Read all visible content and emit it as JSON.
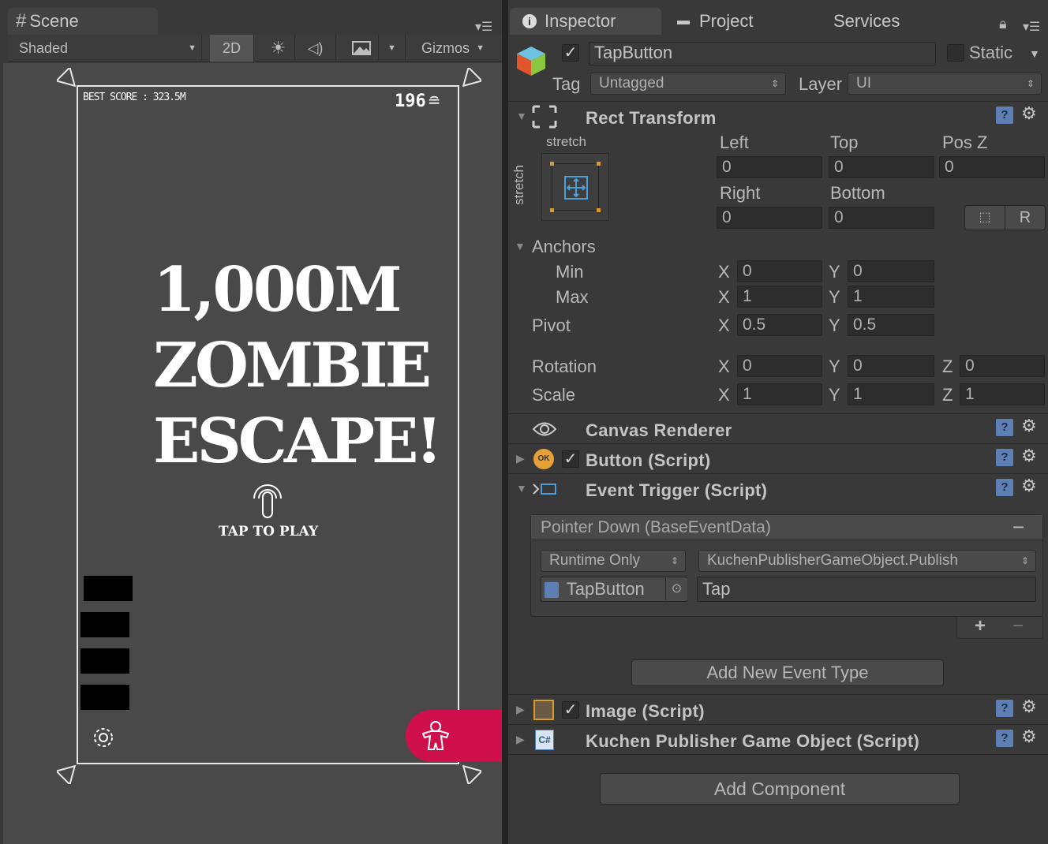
{
  "scene_tab": {
    "label": "Scene"
  },
  "scene_toolbar": {
    "shading": "Shaded",
    "mode_2d": "2D",
    "gizmos": "Gizmos"
  },
  "game": {
    "best_score": "BEST SCORE : 323.5M",
    "coins": "196",
    "title_line1": "1,000M",
    "title_line2": "ZOMBIE",
    "title_line3": "ESCAPE!",
    "tap_to_play": "TAP TO PLAY"
  },
  "inspector_tabs": {
    "inspector": "Inspector",
    "project": "Project",
    "services": "Services"
  },
  "object": {
    "name": "TapButton",
    "static_label": "Static",
    "tag_label": "Tag",
    "tag_value": "Untagged",
    "layer_label": "Layer",
    "layer_value": "UI"
  },
  "rect_transform": {
    "title": "Rect Transform",
    "stretch_h": "stretch",
    "stretch_v": "stretch",
    "left_label": "Left",
    "left": "0",
    "top_label": "Top",
    "top": "0",
    "posz_label": "Pos Z",
    "posz": "0",
    "right_label": "Right",
    "right": "0",
    "bottom_label": "Bottom",
    "bottom": "0",
    "r_button": "R",
    "anchors_label": "Anchors",
    "min_label": "Min",
    "min_x": "0",
    "min_y": "0",
    "max_label": "Max",
    "max_x": "1",
    "max_y": "1",
    "pivot_label": "Pivot",
    "pivot_x": "0.5",
    "pivot_y": "0.5",
    "rotation_label": "Rotation",
    "rot_x": "0",
    "rot_y": "0",
    "rot_z": "0",
    "scale_label": "Scale",
    "scale_x": "1",
    "scale_y": "1",
    "scale_z": "1",
    "axis_x": "X",
    "axis_y": "Y",
    "axis_z": "Z"
  },
  "components": {
    "canvas_renderer": "Canvas Renderer",
    "button": "Button (Script)",
    "event_trigger": "Event Trigger (Script)",
    "image": "Image (Script)",
    "kuchen": "Kuchen Publisher Game Object (Script)",
    "ok_badge": "OK"
  },
  "event": {
    "header": "Pointer Down (BaseEventData)",
    "runtime": "Runtime Only",
    "function": "KuchenPublisherGameObject.Publish",
    "target": "TapButton",
    "argument": "Tap",
    "plus": "+",
    "minus": "−",
    "header_minus": "−",
    "add_event": "Add New Event Type"
  },
  "add_component": "Add Component",
  "help_glyph": "?",
  "gear_glyph": "⚙",
  "colors": {
    "accent_pink": "#d0104c",
    "panel_bg": "#393939",
    "scene_bg": "#494949"
  }
}
